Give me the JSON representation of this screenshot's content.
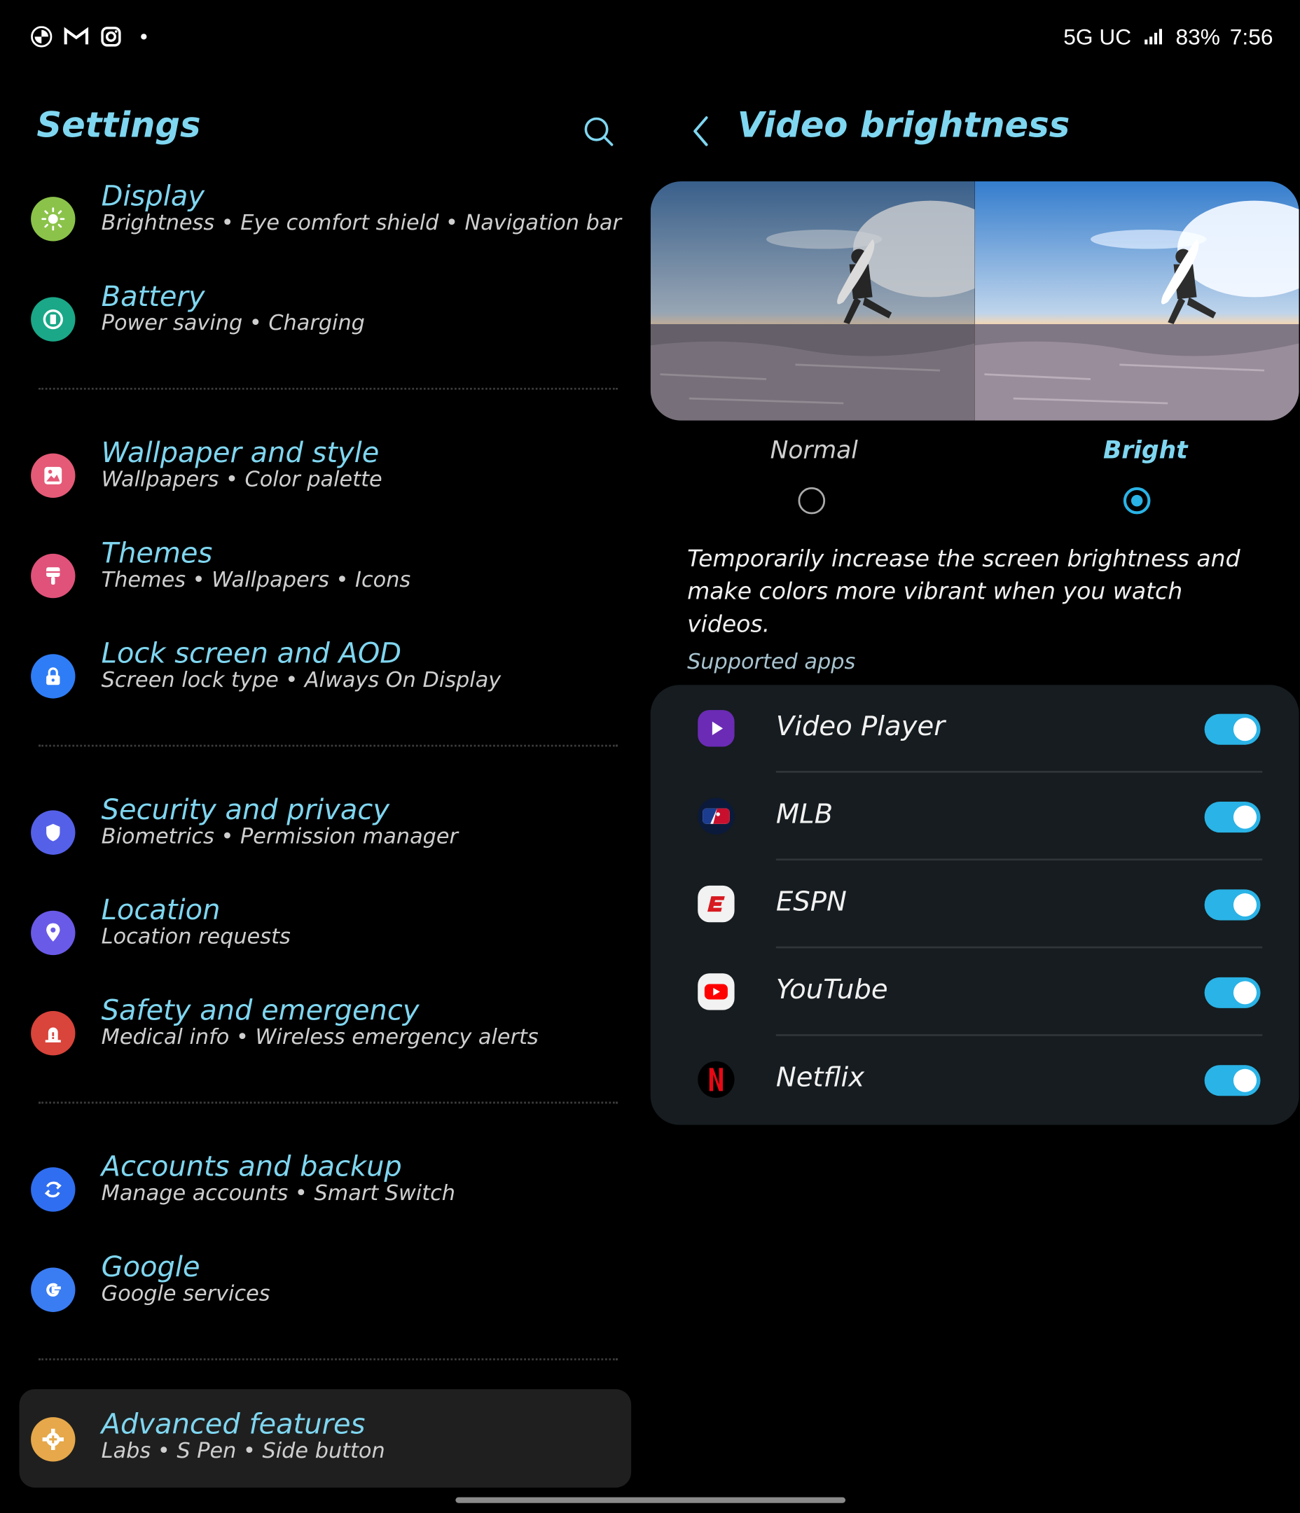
{
  "status": {
    "network": "5G UC",
    "battery": "83%",
    "time": "7:56"
  },
  "settings": {
    "title": "Settings",
    "items": [
      {
        "title": "Display",
        "subtitle": "Brightness  •  Eye comfort shield  •  Navigation bar",
        "icon": "sun-icon",
        "color": "#8bc34a"
      },
      {
        "title": "Battery",
        "subtitle": "Power saving  •  Charging",
        "icon": "battery-icon",
        "color": "#1aa888"
      },
      {
        "title": "Wallpaper and style",
        "subtitle": "Wallpapers  •  Color palette",
        "icon": "image-icon",
        "color": "#e55a77"
      },
      {
        "title": "Themes",
        "subtitle": "Themes  •  Wallpapers  •  Icons",
        "icon": "paintbrush-icon",
        "color": "#e0527a"
      },
      {
        "title": "Lock screen and AOD",
        "subtitle": "Screen lock type  •  Always On Display",
        "icon": "lock-icon",
        "color": "#2f7df6"
      },
      {
        "title": "Security and privacy",
        "subtitle": "Biometrics  •  Permission manager",
        "icon": "shield-icon",
        "color": "#5560e8"
      },
      {
        "title": "Location",
        "subtitle": "Location requests",
        "icon": "location-pin-icon",
        "color": "#6a5ae8"
      },
      {
        "title": "Safety and emergency",
        "subtitle": "Medical info  •  Wireless emergency alerts",
        "icon": "alert-icon",
        "color": "#d9443b"
      },
      {
        "title": "Accounts and backup",
        "subtitle": "Manage accounts  •  Smart Switch",
        "icon": "sync-icon",
        "color": "#2f6ef0"
      },
      {
        "title": "Google",
        "subtitle": "Google services",
        "icon": "google-icon",
        "color": "#3a7cf2"
      },
      {
        "title": "Advanced features",
        "subtitle": "Labs  •  S Pen  •  Side button",
        "icon": "gear-plus-icon",
        "color": "#e6a84a"
      }
    ]
  },
  "video": {
    "title": "Video brightness",
    "options": [
      {
        "label": "Normal",
        "selected": false
      },
      {
        "label": "Bright",
        "selected": true
      }
    ],
    "description": "Temporarily increase the screen brightness and make colors more vibrant when you watch videos.",
    "supported_heading": "Supported apps",
    "apps": [
      {
        "name": "Video Player",
        "enabled": true,
        "icon": "play-icon"
      },
      {
        "name": "MLB",
        "enabled": true,
        "icon": "mlb-icon"
      },
      {
        "name": "ESPN",
        "enabled": true,
        "icon": "espn-icon"
      },
      {
        "name": "YouTube",
        "enabled": true,
        "icon": "youtube-icon"
      },
      {
        "name": "Netflix",
        "enabled": true,
        "icon": "netflix-icon"
      }
    ]
  }
}
